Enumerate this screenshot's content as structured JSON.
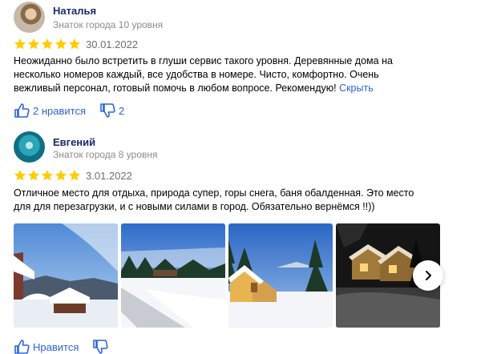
{
  "reviews": [
    {
      "author": "Наталья",
      "level": "Знаток города 10 уровня",
      "rating": 5,
      "date": "30.01.2022",
      "text": "Неожиданно было встретить в глуши сервис такого уровня. Деревянные дома на несколько номеров каждый, все удобства в номере. Чисто, комфортно. Очень вежливый персонал, готовый помочь в любом вопросе. Рекомендую! ",
      "hide_label": "Скрыть",
      "likes_label": "2 нравится",
      "dislikes_label": "2"
    },
    {
      "author": "Евгений",
      "level": "Знаток города 8 уровня",
      "rating": 5,
      "date": "3.01.2022",
      "text": "Отличное место для отдыха, природа супер, горы снега, баня обалденная. Это место для для перезагрузки, и с новыми силами в город. Обязательно вернёмся !!))",
      "likes_label": "Нравится",
      "photos": [
        "snowy-village-photo",
        "snow-road-photo",
        "snow-cabins-photo",
        "night-cabins-photo"
      ]
    }
  ],
  "colors": {
    "author": "#1a2a6c",
    "star": "#fc0",
    "link": "#2c64d7",
    "muted": "#8c8c8c"
  }
}
